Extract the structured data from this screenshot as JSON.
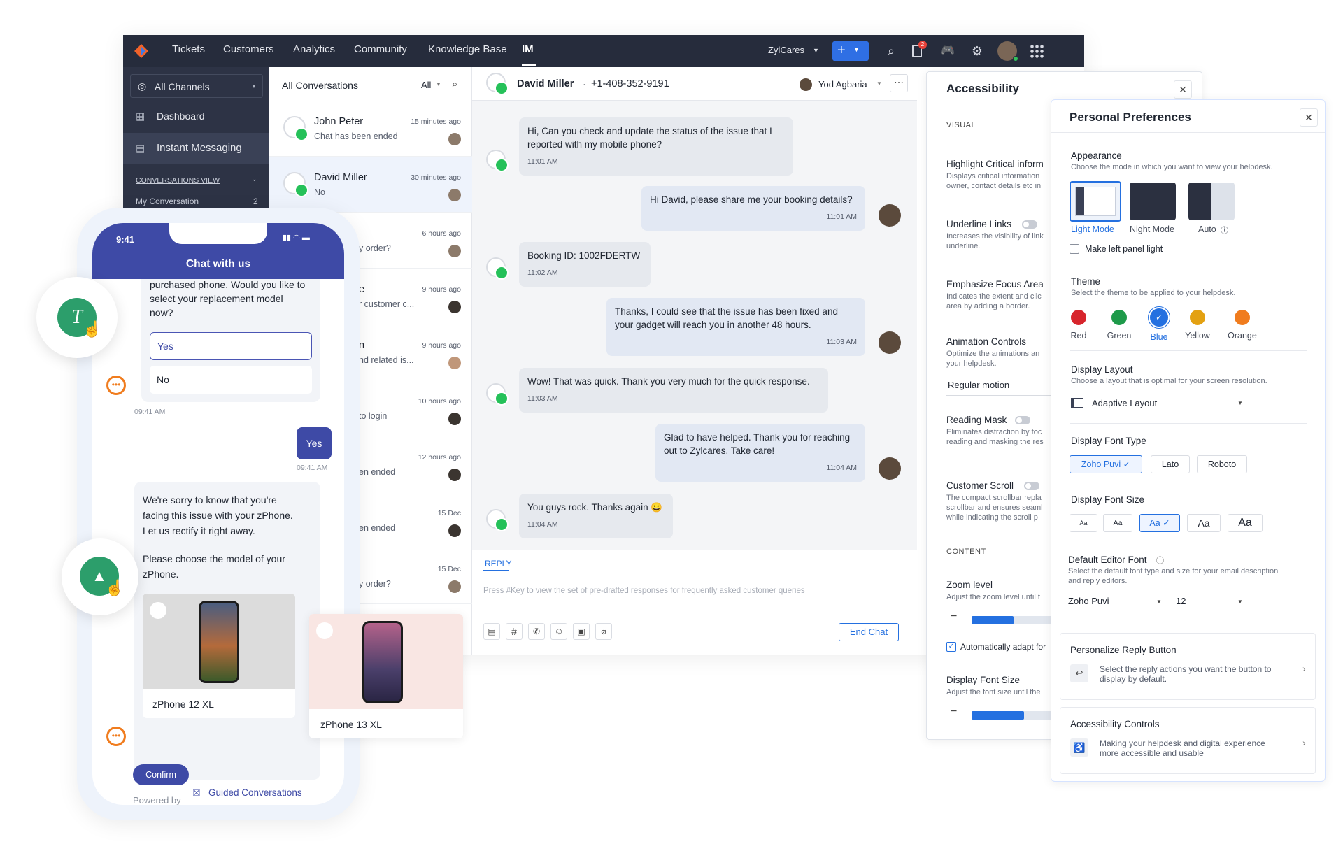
{
  "topbar": {
    "nav": [
      "Tickets",
      "Customers",
      "Analytics",
      "Community",
      "Knowledge Base",
      "IM"
    ],
    "org": "ZylCares",
    "notification_count": "2"
  },
  "sidebar": {
    "channel_select": "All Channels",
    "items": [
      "Dashboard",
      "Instant Messaging"
    ],
    "section_label": "CONVERSATIONS VIEW",
    "view_item": "My Conversation",
    "view_count": "2"
  },
  "conversations": {
    "header": "All Conversations",
    "filter": "All",
    "items": [
      {
        "name": "John Peter",
        "msg": "Chat has been ended",
        "time": "15 minutes ago"
      },
      {
        "name": "David Miller",
        "msg": "No",
        "time": "30 minutes ago"
      },
      {
        "name": "",
        "msg": "y order?",
        "time": "6 hours ago"
      },
      {
        "name": "e",
        "msg": "r customer c...",
        "time": "9 hours ago"
      },
      {
        "name": "n",
        "msg": "nd related is...",
        "time": "9 hours ago"
      },
      {
        "name": "",
        "msg": "to login",
        "time": "10 hours ago"
      },
      {
        "name": "",
        "msg": "en ended",
        "time": "12 hours ago"
      },
      {
        "name": "",
        "msg": "en ended",
        "time": "15 Dec"
      },
      {
        "name": "",
        "msg": "y order?",
        "time": "15 Dec"
      }
    ]
  },
  "chat": {
    "contact": "David Miller",
    "phone": "+1-408-352-9191",
    "agent": "Yod Agbaria",
    "messages": [
      {
        "text": "Hi, Can you check and update the status of the issue that I reported with my mobile phone?",
        "time": "11:01 AM"
      },
      {
        "text": "Hi David, please share me your booking details?",
        "time": "11:01 AM"
      },
      {
        "text": "Booking ID: 1002FDERTW",
        "time": "11:02 AM"
      },
      {
        "text": "Thanks, I could see that the issue has been fixed and your gadget will reach you in another 48 hours.",
        "time": "11:03 AM"
      },
      {
        "text": "Wow! That was quick. Thank you very much for the quick response.",
        "time": "11:03 AM"
      },
      {
        "text": "Glad to have helped. Thank you for reaching out to Zylcares. Take care!",
        "time": "11:04 AM"
      },
      {
        "text": "You guys rock. Thanks again 😀",
        "time": "11:04 AM"
      }
    ],
    "reply_tab": "REPLY",
    "reply_placeholder": "Press #Key to view the set of pre-drafted responses for frequently asked customer queries",
    "end_chat": "End Chat"
  },
  "accessibility": {
    "title": "Accessibility",
    "visual_label": "VISUAL",
    "items": [
      {
        "title": "Highlight Critical inform",
        "desc1": "Displays critical information",
        "desc2": "owner, contact details etc in"
      },
      {
        "title": "Underline Links",
        "desc1": "Increases the visibility of link",
        "desc2": "underline."
      },
      {
        "title": "Emphasize Focus Area",
        "desc1": "Indicates the extent and clic",
        "desc2": "area by adding a border."
      },
      {
        "title": "Animation Controls",
        "desc1": "Optimize the animations an",
        "desc2": "your helpdesk."
      },
      {
        "title": "Reading Mask",
        "desc1": "Eliminates distraction by foc",
        "desc2": "reading and masking the res"
      },
      {
        "title": "Customer Scroll",
        "desc1": "The compact scrollbar repla",
        "desc2": "scrollbar and ensures seaml",
        "desc3": "while indicating the scroll p"
      }
    ],
    "motion_value": "Regular motion",
    "content_label": "CONTENT",
    "zoom_title": "Zoom level",
    "zoom_desc": "Adjust the zoom level until t",
    "zoom_level": 0.4,
    "auto_adapt": "Automatically adapt for",
    "font_size_title": "Display Font Size",
    "font_size_desc": "Adjust the font size until the",
    "font_size_level": 0.5
  },
  "preferences": {
    "title": "Personal Preferences",
    "appearance_title": "Appearance",
    "appearance_desc": "Choose the mode in which you want to view your helpdesk.",
    "modes": [
      "Light Mode",
      "Night Mode",
      "Auto"
    ],
    "left_panel": "Make left panel light",
    "theme_title": "Theme",
    "theme_desc": "Select the theme to be applied to your helpdesk.",
    "themes": [
      {
        "name": "Red",
        "color": "#d7252c"
      },
      {
        "name": "Green",
        "color": "#1e9a4a"
      },
      {
        "name": "Blue",
        "color": "#2470e0"
      },
      {
        "name": "Yellow",
        "color": "#e3a112"
      },
      {
        "name": "Orange",
        "color": "#f07c1e"
      }
    ],
    "layout_title": "Display Layout",
    "layout_desc": "Choose a layout that is optimal for your screen resolution.",
    "layout_value": "Adaptive Layout",
    "font_type_title": "Display Font Type",
    "font_types": [
      "Zoho Puvi",
      "Lato",
      "Roboto"
    ],
    "font_size_title": "Display Font Size",
    "font_sizes": [
      "Aa",
      "Aa",
      "Aa",
      "Aa",
      "Aa"
    ],
    "editor_title": "Default Editor Font",
    "editor_desc1": "Select the default font type and size for your email description",
    "editor_desc2": "and reply editors.",
    "editor_font": "Zoho Puvi",
    "editor_size": "12",
    "reply_title": "Personalize Reply Button",
    "reply_desc1": "Select the reply actions you want the button to",
    "reply_desc2": "display by default.",
    "acc_title": "Accessibility Controls",
    "acc_desc1": "Making your helpdesk and digital experience",
    "acc_desc2": "more accessible and usable"
  },
  "phone": {
    "time": "9:41",
    "header": "Chat with us",
    "bot_msg1a": "purchased phone. Would you like to",
    "bot_msg1b": "select your replacement model",
    "bot_msg1c": "now?",
    "opt_yes": "Yes",
    "opt_no": "No",
    "time1": "09:41 AM",
    "user_reply": "Yes",
    "time2": "09:41 AM",
    "bot_msg2a": "We're sorry to know that you're",
    "bot_msg2b": "facing this issue with your zPhone.",
    "bot_msg2c": "Let us rectify it right away.",
    "bot_msg3a": "Please choose the model of your",
    "bot_msg3b": "zPhone.",
    "product1": "zPhone 12 XL",
    "product2": "zPhone 13 XL",
    "confirm": "Confirm",
    "powered": "Powered by",
    "powered_link": "Guided Conversations"
  },
  "colors": {
    "accent": "#2470e0",
    "topbar": "#262c3c",
    "sidebar": "#2d3345",
    "whatsapp": "#25c159",
    "phone_header": "#3e4aa6",
    "bot": "#2c9e6b"
  }
}
